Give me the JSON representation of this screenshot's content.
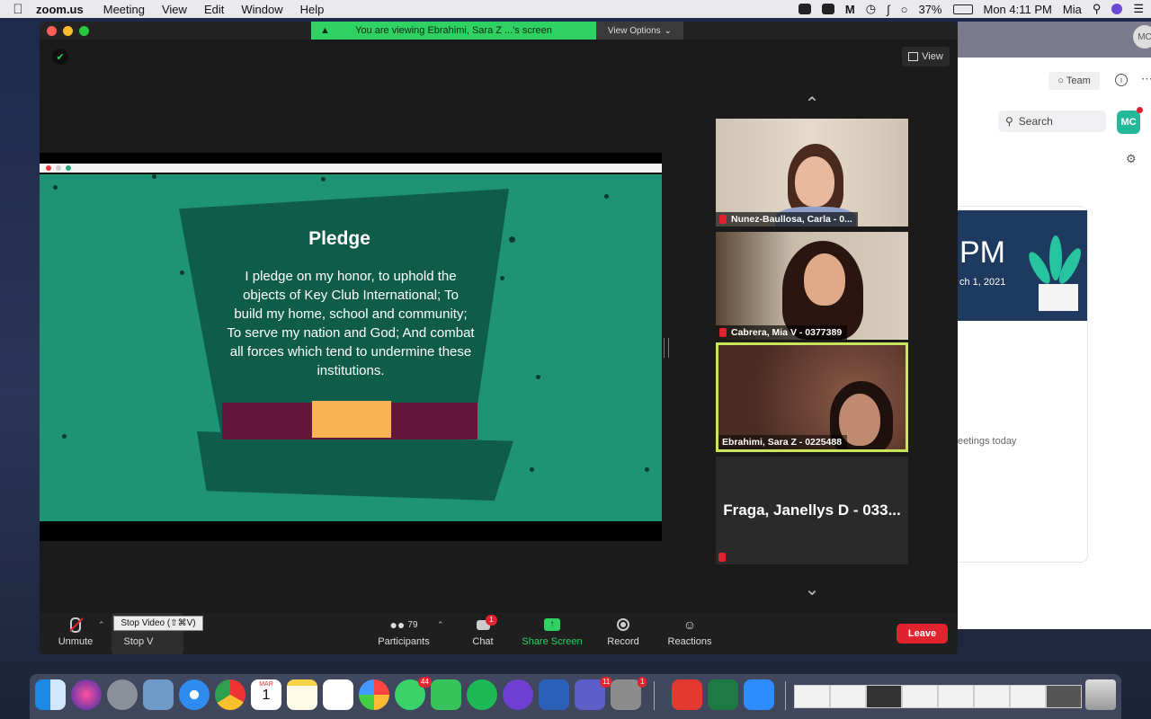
{
  "menubar": {
    "app": "zoom.us",
    "items": [
      "Meeting",
      "View",
      "Edit",
      "Window",
      "Help"
    ],
    "battery": "37%",
    "clock": "Mon 4:11 PM",
    "user": "Mia"
  },
  "zoom": {
    "banner": "You are viewing Ebrahimi, Sara Z ...'s screen",
    "view_options": "View Options",
    "view_button": "View",
    "slide": {
      "title": "Pledge",
      "lines": [
        "I pledge on my honor, to uphold the",
        "objects of Key Club International; To",
        "build my home, school and community;",
        "To serve my nation and God; And combat",
        "all forces which tend to undermine these",
        "institutions."
      ]
    },
    "participants": [
      {
        "name": "Nunez-Baullosa, Carla - 0..."
      },
      {
        "name": "Cabrera, Mia V - 0377389"
      },
      {
        "name": "Ebrahimi, Sara Z - 0225488"
      },
      {
        "name": "Fraga, Janellys D - 033..."
      }
    ],
    "toolbar": {
      "unmute": "Unmute",
      "stop_video": "Stop V",
      "tooltip": "Stop Video (⇧⌘V)",
      "participants": "Participants",
      "participants_count": "79",
      "chat": "Chat",
      "chat_badge": "1",
      "share_screen": "Share Screen",
      "record": "Record",
      "reactions": "Reactions",
      "leave": "Leave"
    }
  },
  "background_app": {
    "avatar": "MC",
    "team": "Team",
    "search": "Search",
    "badge": "MC",
    "banner_time": "PM",
    "banner_date": "ch 1, 2021",
    "no_meetings": "eetings today"
  },
  "dock": {
    "calendar_month": "MAR",
    "calendar_day": "1",
    "messages_badge": "44",
    "teams_badge": "11",
    "prefs_badge": "1"
  }
}
